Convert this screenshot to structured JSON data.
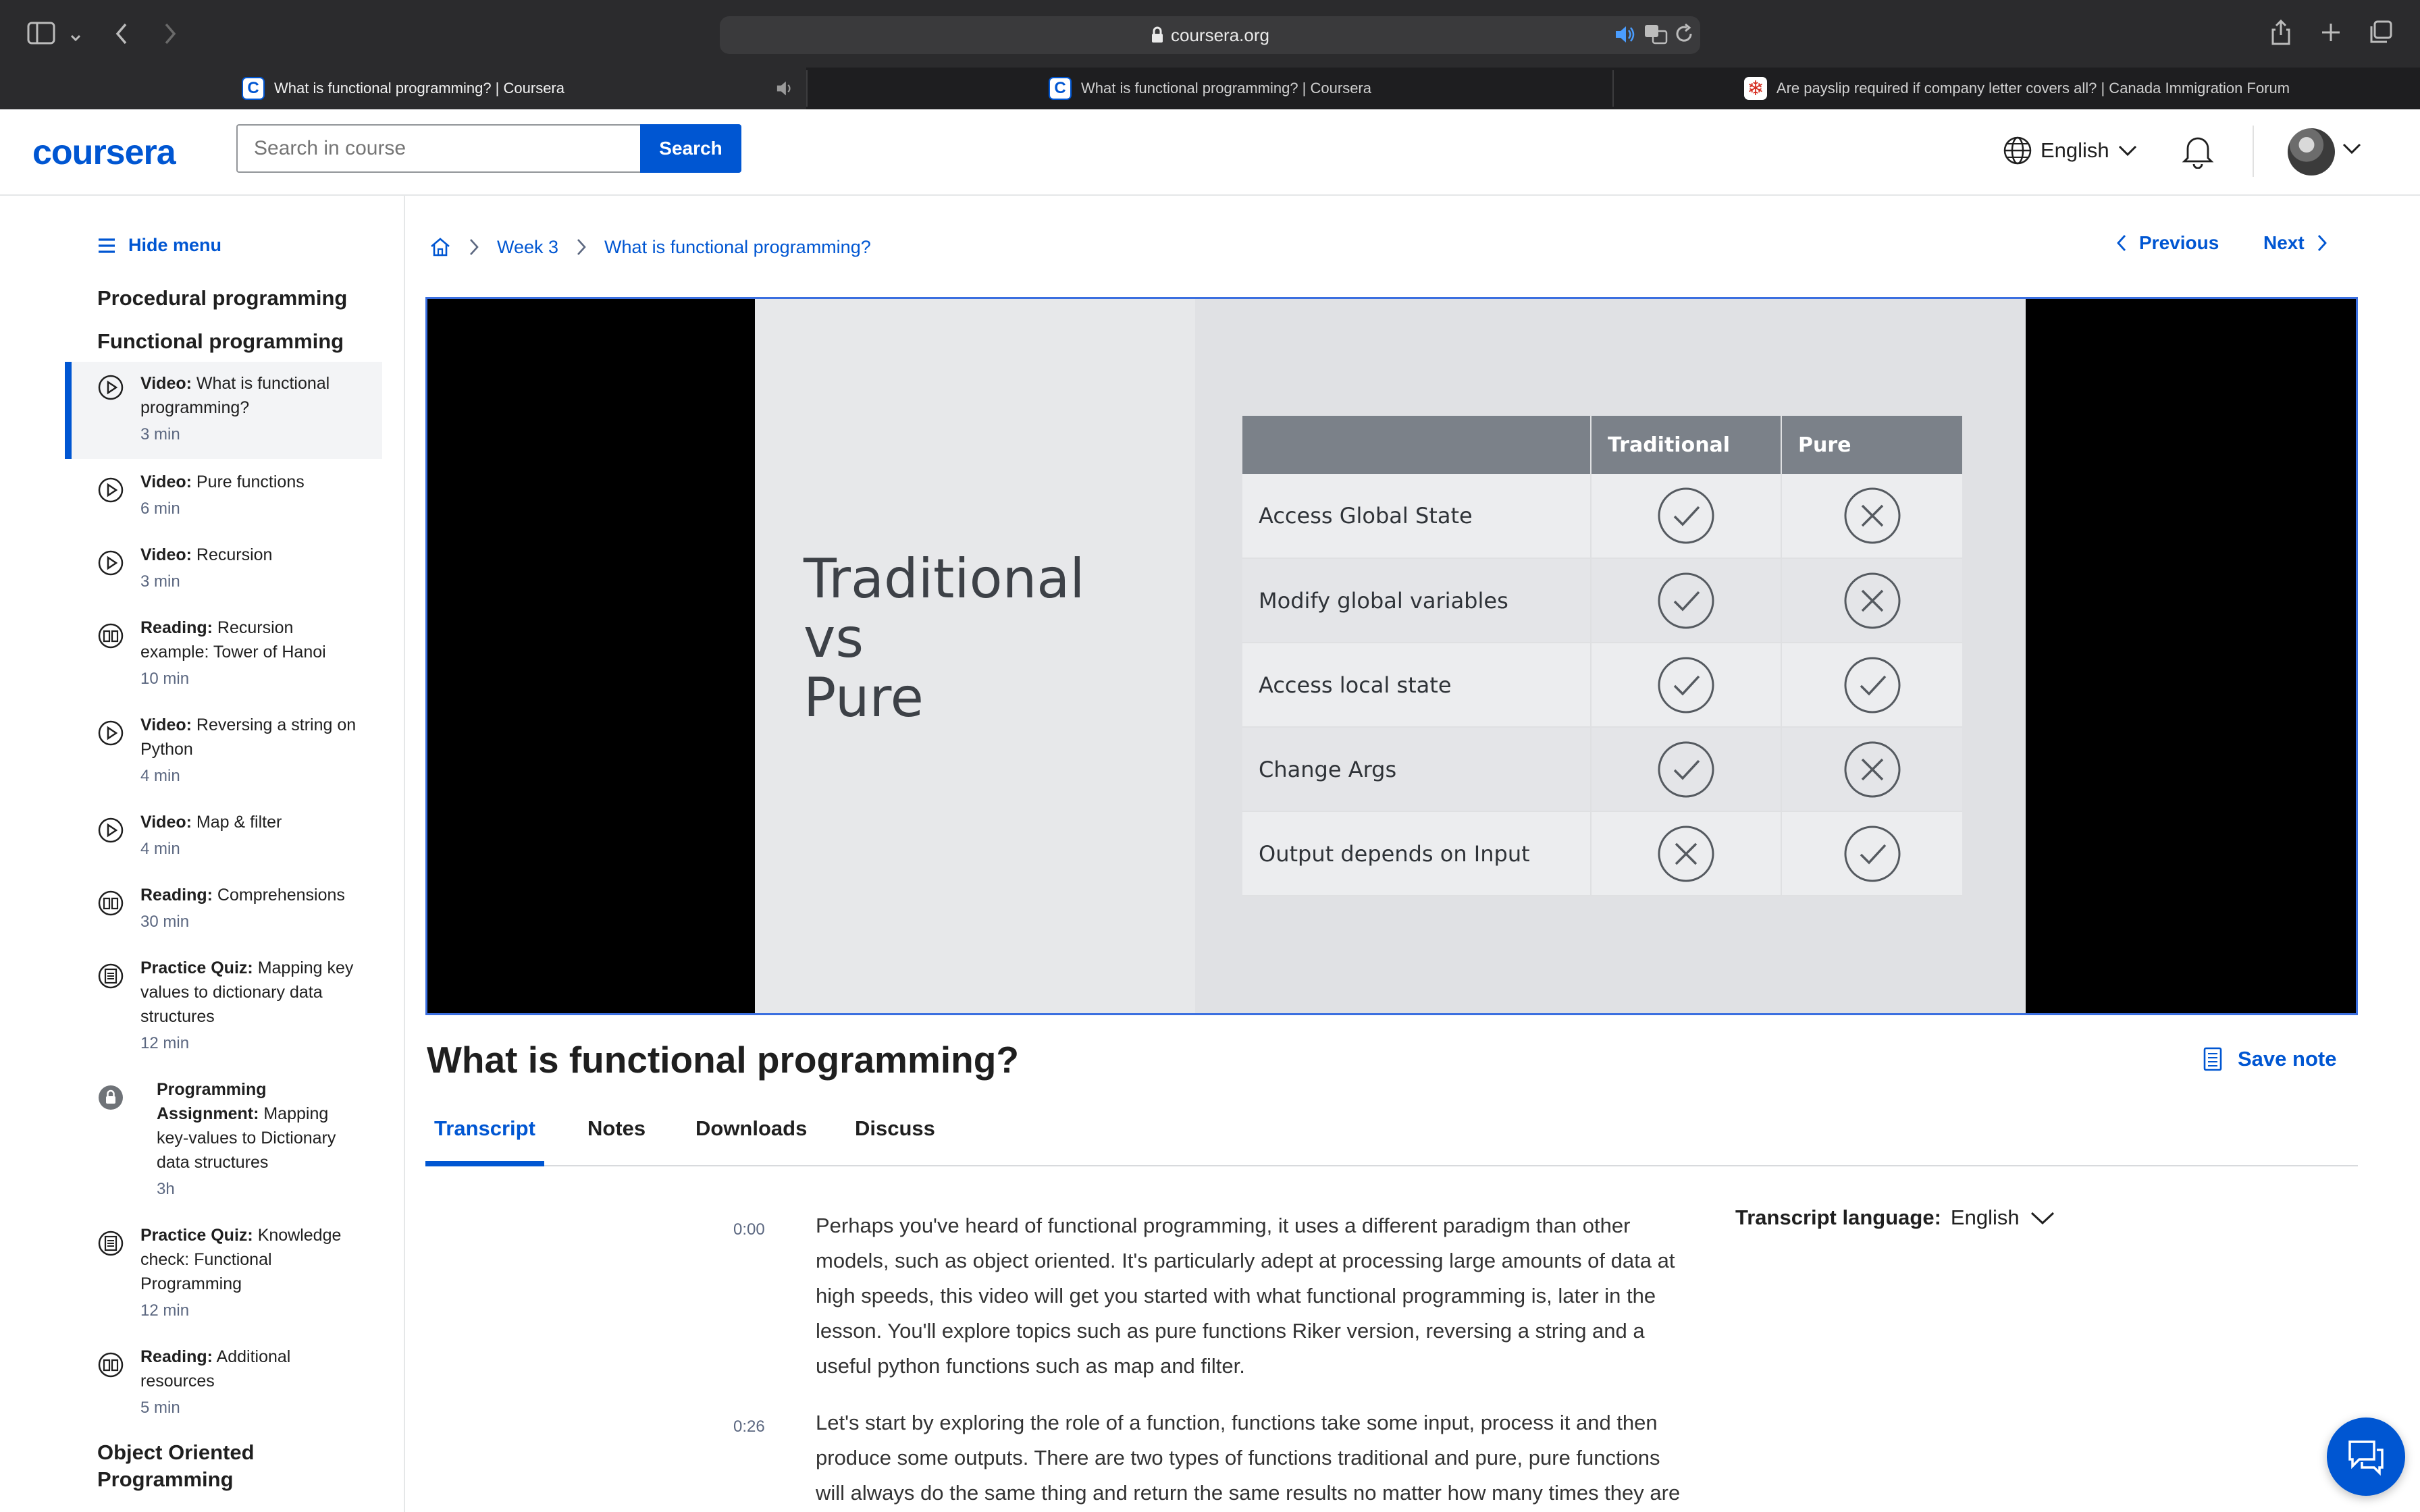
{
  "browser": {
    "url": "coursera.org",
    "tabs": [
      {
        "title": "What is functional programming? | Coursera",
        "active": true
      },
      {
        "title": "What is functional programming? | Coursera",
        "active": false
      },
      {
        "title": "Are payslip required if company letter covers all? | Canada Immigration Forum",
        "active": false
      }
    ]
  },
  "header": {
    "logo": "coursera",
    "search_placeholder": "Search in course",
    "search_button": "Search",
    "language": "English"
  },
  "sidebar": {
    "hide_menu": "Hide menu",
    "section1": "Procedural programming",
    "section2": "Functional programming",
    "items": [
      {
        "type": "Video:",
        "title": "What is functional programming?",
        "duration": "3 min",
        "icon": "play-icon"
      },
      {
        "type": "Video:",
        "title": "Pure functions",
        "duration": "6 min",
        "icon": "play-icon"
      },
      {
        "type": "Video:",
        "title": "Recursion",
        "duration": "3 min",
        "icon": "play-icon"
      },
      {
        "type": "Reading:",
        "title": "Recursion example: Tower of Hanoi",
        "duration": "10 min",
        "icon": "book-icon"
      },
      {
        "type": "Video:",
        "title": "Reversing a string on Python",
        "duration": "4 min",
        "icon": "play-icon"
      },
      {
        "type": "Video:",
        "title": "Map & filter",
        "duration": "4 min",
        "icon": "play-icon"
      },
      {
        "type": "Reading:",
        "title": "Comprehensions",
        "duration": "30 min",
        "icon": "book-icon"
      },
      {
        "type": "Practice Quiz:",
        "title": "Mapping key values to dictionary data structures",
        "duration": "12 min",
        "icon": "quiz-icon"
      },
      {
        "type": "Programming Assignment:",
        "title": "Mapping key-values to Dictionary data structures",
        "duration": "3h",
        "icon": "lock-icon"
      },
      {
        "type": "Practice Quiz:",
        "title": "Knowledge check: Functional Programming",
        "duration": "12 min",
        "icon": "quiz-icon"
      },
      {
        "type": "Reading:",
        "title": "Additional resources",
        "duration": "5 min",
        "icon": "book-icon"
      }
    ],
    "section3": "Object Oriented Programming"
  },
  "breadcrumb": {
    "week": "Week 3",
    "current": "What is functional programming?"
  },
  "nav": {
    "previous": "Previous",
    "next": "Next"
  },
  "slide": {
    "title_lines": [
      "Traditional",
      "vs",
      "Pure"
    ],
    "columns": [
      "",
      "Traditional",
      "Pure"
    ],
    "rows": [
      {
        "label": "Access Global State",
        "traditional": "check",
        "pure": "cross"
      },
      {
        "label": "Modify global variables",
        "traditional": "check",
        "pure": "cross"
      },
      {
        "label": "Access local state",
        "traditional": "check",
        "pure": "check"
      },
      {
        "label": "Change Args",
        "traditional": "check",
        "pure": "cross"
      },
      {
        "label": "Output depends on Input",
        "traditional": "cross",
        "pure": "check"
      }
    ]
  },
  "lesson": {
    "title": "What is functional programming?",
    "save_note": "Save note",
    "tabs": [
      "Transcript",
      "Notes",
      "Downloads",
      "Discuss"
    ]
  },
  "transcript": {
    "language_label": "Transcript language:",
    "language": "English",
    "entries": [
      {
        "time": "0:00",
        "text": "Perhaps you've heard of functional programming, it uses a different paradigm than other models, such as object oriented. It's particularly adept at processing large amounts of data at high speeds, this video will get you started with what functional programming is, later in the lesson. You'll explore topics such as pure functions Riker version, reversing a string and a useful python functions such as map and filter."
      },
      {
        "time": "0:26",
        "text": "Let's start by exploring the role of a function, functions take some input, process it and then produce some outputs. There are two types of functions traditional and pure, pure functions will always do the same thing and return the same results no matter how many times they are"
      }
    ]
  },
  "colors": {
    "accent": "#0056d2",
    "chrome": "#2b2b2d"
  }
}
